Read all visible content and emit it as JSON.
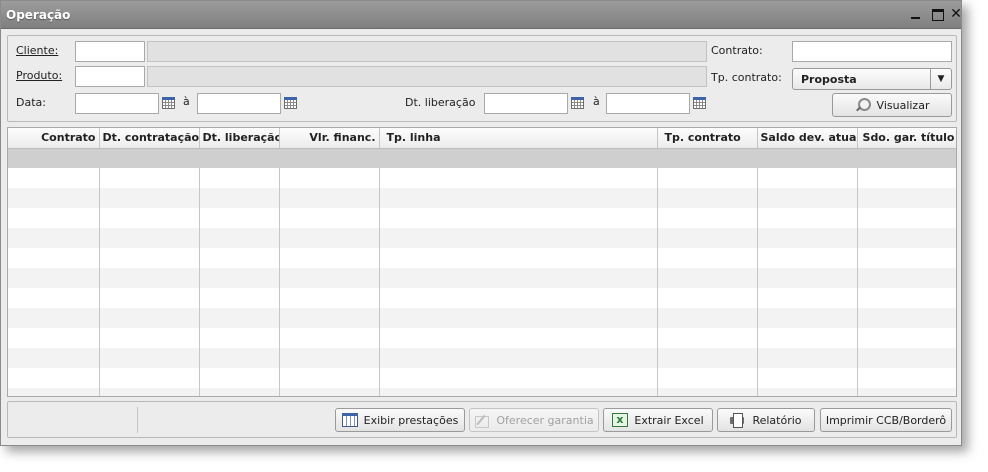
{
  "window": {
    "title": "Operação"
  },
  "filters": {
    "cliente_label": "Cliente:",
    "produto_label": "Produto:",
    "data_label": "Data:",
    "data_sep": "à",
    "dt_liberacao_label": "Dt. liberação",
    "dt_liberacao_sep": "à",
    "contrato_label": "Contrato:",
    "tp_contrato_label": "Tp. contrato:",
    "tp_contrato_value": "Proposta",
    "visualizar_label": "Visualizar"
  },
  "table": {
    "columns": [
      "Contrato",
      "Dt. contratação",
      "Dt. liberação",
      "Vlr. financ.",
      "Tp. linha",
      "Tp. contrato",
      "Saldo dev. atual",
      "Sdo. gar. título"
    ]
  },
  "actions": {
    "exibir_prestacoes": "Exibir prestações",
    "oferecer_garantia": "Oferecer garantia",
    "extrair_excel": "Extrair Excel",
    "relatorio": "Relatório",
    "imprimir": "Imprimir CCB/Borderô"
  },
  "colors": {
    "titlebar": "#8f8f8f",
    "selected_row": "#cfcfcf",
    "calendar_accent": "#3d63a8"
  }
}
